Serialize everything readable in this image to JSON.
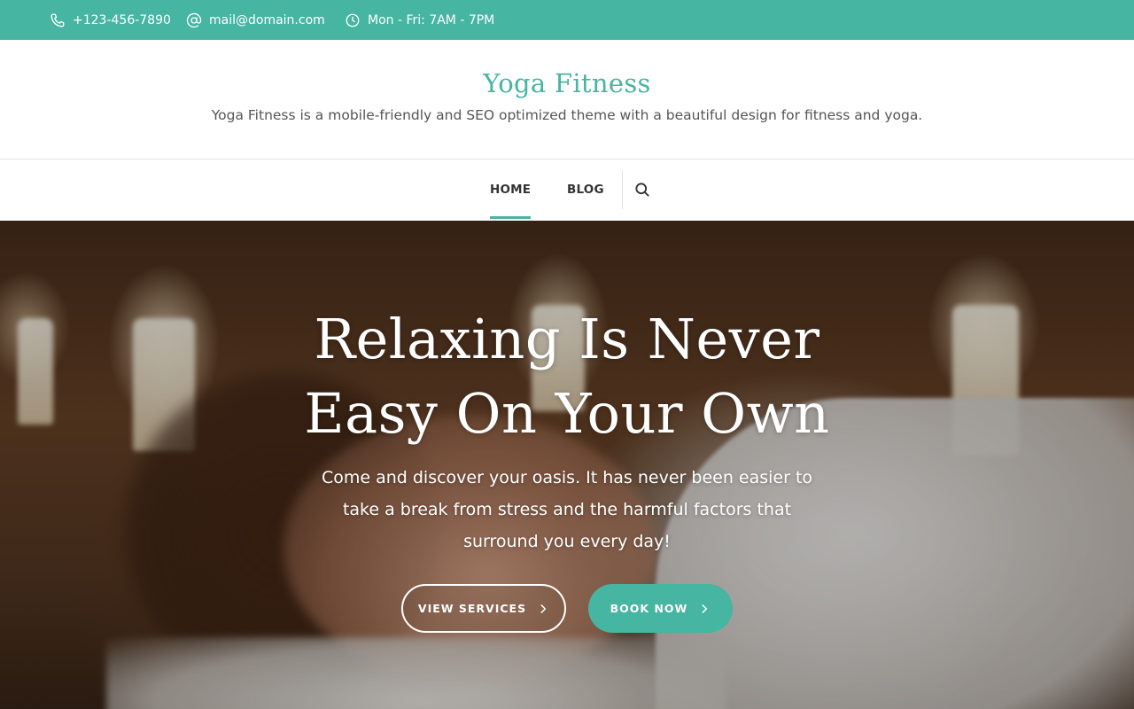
{
  "topbar": {
    "phone": "+123-456-7890",
    "email": "mail@domain.com",
    "hours": "Mon - Fri: 7AM - 7PM",
    "background_color": "#46b5a1"
  },
  "branding": {
    "site_title": "Yoga Fitness",
    "site_description": "Yoga Fitness is a mobile-friendly and SEO optimized theme with a beautiful design for fitness and yoga.",
    "accent_color": "#46b5a1"
  },
  "nav": {
    "items": [
      {
        "label": "HOME",
        "active": true
      },
      {
        "label": "BLOG",
        "active": false
      }
    ],
    "search_icon": "search-icon"
  },
  "hero": {
    "title_line1": "Relaxing Is Never",
    "title_line2": "Easy On Your Own",
    "text": "Come and discover your oasis. It has never been easier to take a break from stress and the harmful factors that surround you every day!",
    "buttons": {
      "services_label": "VIEW SERVICES",
      "book_label": "BOOK NOW"
    }
  }
}
